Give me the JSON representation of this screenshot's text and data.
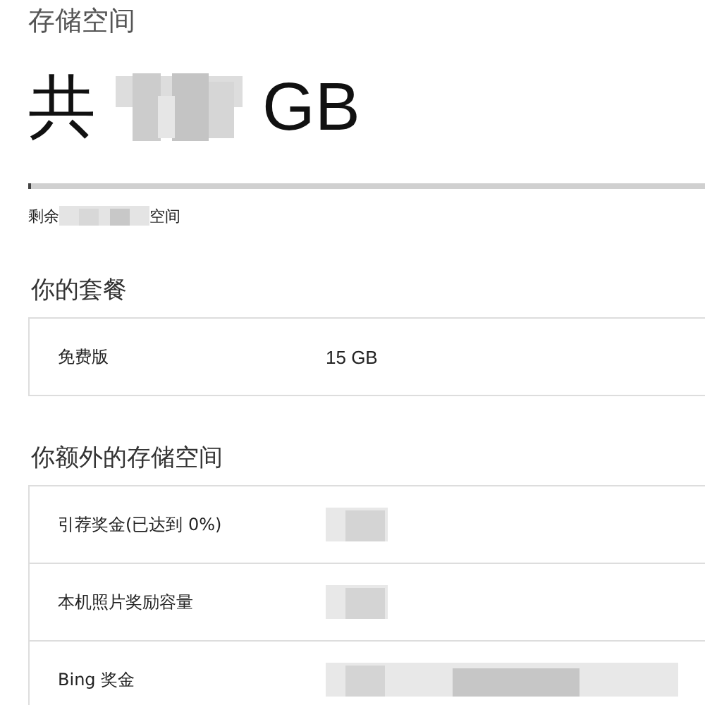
{
  "heading": "存储空间",
  "total": {
    "prefix": "共",
    "unit": "GB"
  },
  "usage": {
    "level": 0.005,
    "remaining_prefix": "剩余",
    "remaining_suffix": "空间"
  },
  "plan": {
    "title": "你的套餐",
    "rows": [
      {
        "name": "免费版",
        "value": "15 GB"
      }
    ]
  },
  "extra": {
    "title": "你额外的存储空间",
    "rows": [
      {
        "name": "引荐奖金(已达到 0%)"
      },
      {
        "name": "本机照片奖励容量"
      },
      {
        "name": "Bing 奖金"
      }
    ]
  }
}
